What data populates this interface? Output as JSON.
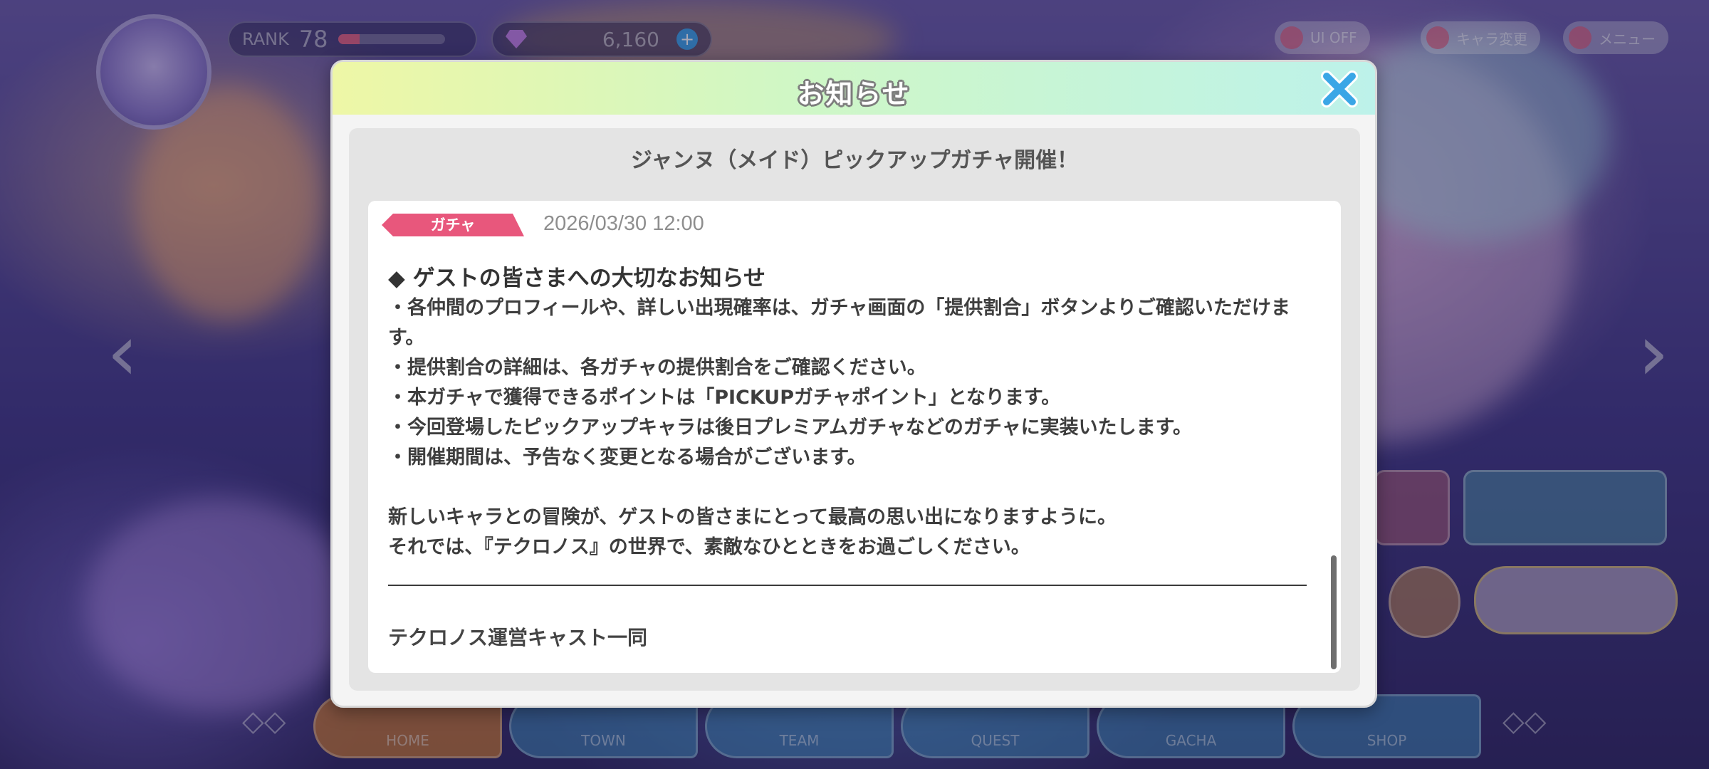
{
  "background": {
    "rank_label": "RANK",
    "rank_value": "78",
    "gems": "6,160",
    "top_buttons": [
      "UI OFF",
      "キャラ変更",
      "メニュー"
    ],
    "nav_tabs": [
      "HOME",
      "TOWN",
      "TEAM",
      "QUEST",
      "GACHA",
      "SHOP"
    ]
  },
  "modal": {
    "title": "お知らせ",
    "heading": "ジャンヌ（メイド）ピックアップガチャ開催！",
    "notice": {
      "tag": "ガチャ",
      "tag_color": "#e8577c",
      "date": "2026/03/30 12:00",
      "section_title": "◆ ゲストの皆さまへの大切なお知らせ",
      "lines": [
        "・各仲間のプロフィールや、詳しい出現確率は、ガチャ画面の「提供割合」ボタンよりご確認いただけます。",
        "・提供割合の詳細は、各ガチャの提供割合をご確認ください。",
        "・本ガチャで獲得できるポイントは「PICKUPガチャポイント」となります。",
        "・今回登場したピックアップキャラは後日プレミアムガチャなどのガチャに実装いたします。",
        "・開催期間は、予告なく変更となる場合がございます。"
      ],
      "closing_lines": [
        "新しいキャラとの冒険が、ゲストの皆さまにとって最高の思い出になりますように。",
        "それでは、『テクロノス』の世界で、素敵なひとときをお過ごしください。"
      ],
      "signature": "テクロノス運営キャスト一同"
    },
    "close_icon": "close-x-icon",
    "close_color": "#3aa6e6"
  }
}
